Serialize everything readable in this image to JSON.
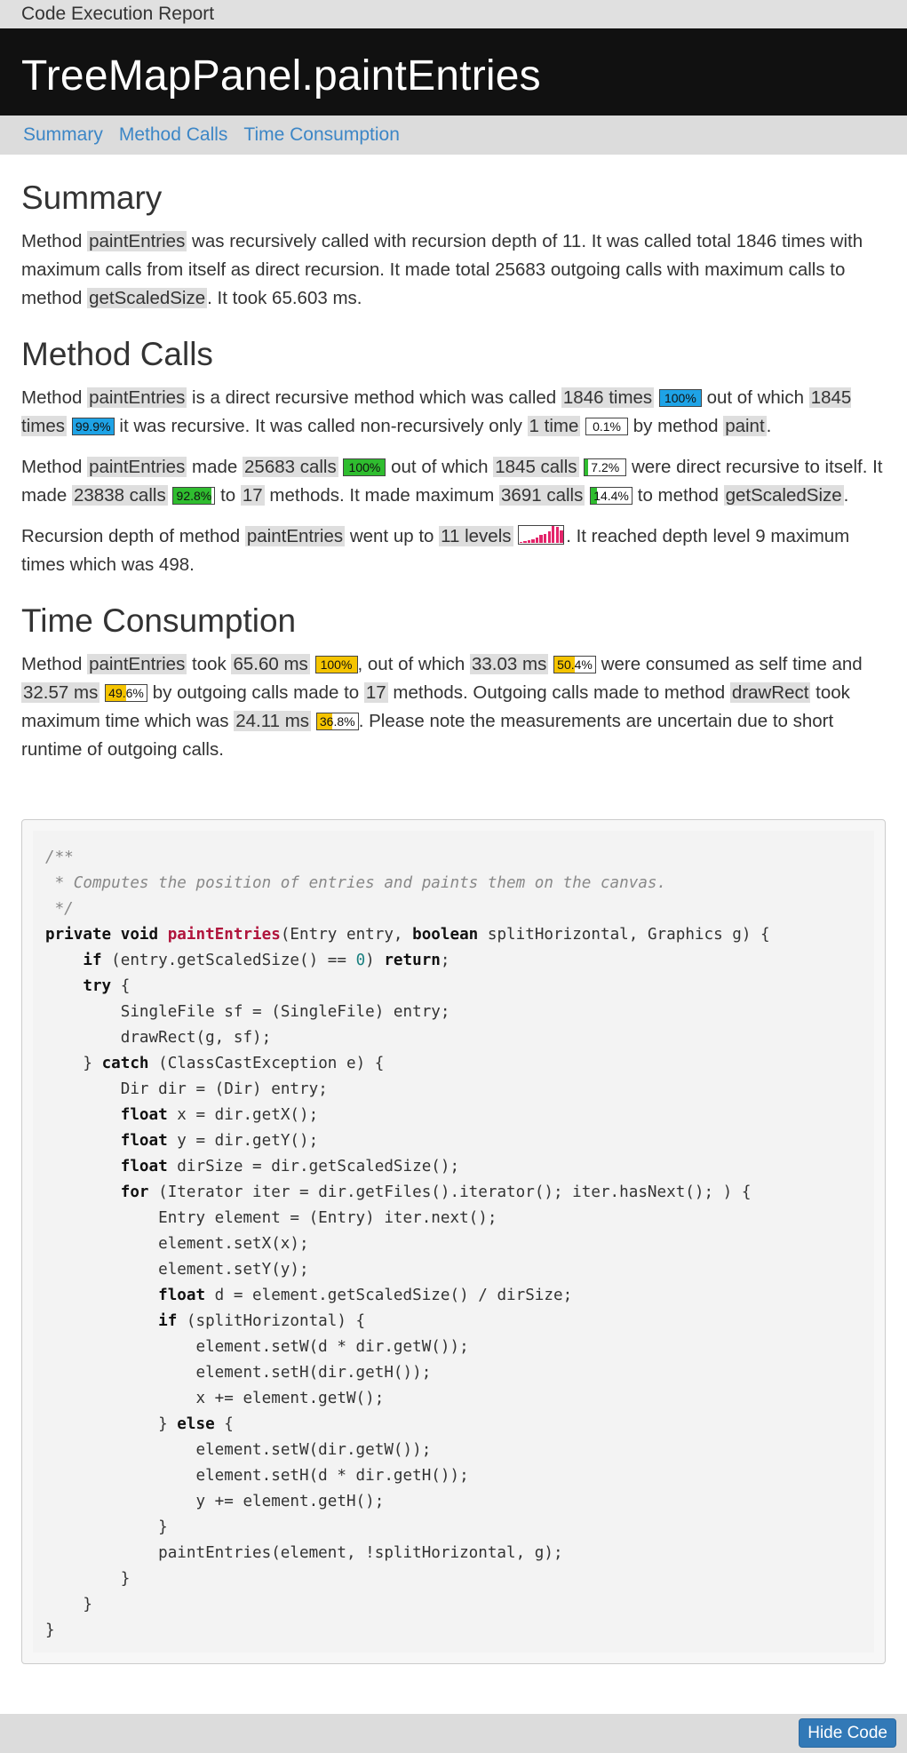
{
  "header": {
    "report_label": "Code Execution Report",
    "title": "TreeMapPanel.paintEntries"
  },
  "nav": {
    "summary": "Summary",
    "method_calls": "Method Calls",
    "time": "Time Consumption"
  },
  "colors": {
    "blue": "#1ea3e6",
    "green": "#2fbd2f",
    "yellow": "#f5c400",
    "depth_bar": "#e4246a",
    "title_bg": "#111111",
    "button": "#3279b7"
  },
  "summary": {
    "heading": "Summary",
    "t1": "Method ",
    "method": "paintEntries",
    "t2": " was recursively called with recursion depth of 11. It was called total 1846 times with maximum calls from itself as direct recursion. It made total 25683 outgoing calls with maximum calls to method ",
    "target": "getScaledSize",
    "t3": ". It took 65.603 ms."
  },
  "method_calls": {
    "heading": "Method Calls",
    "p1": {
      "a": "Method ",
      "method": "paintEntries",
      "b": " is a direct recursive method which was called ",
      "called": "1846 times",
      "called_pct": "100%",
      "c": " out of which ",
      "recursive": "1845 times",
      "recursive_pct": "99.9%",
      "d": " it was recursive. It was called non-recursively only ",
      "nonrec": "1 time",
      "nonrec_pct": "0.1%",
      "e": " by method ",
      "caller": "paint",
      "f": "."
    },
    "p2": {
      "a": "Method ",
      "method": "paintEntries",
      "b": " made ",
      "calls": "25683 calls",
      "calls_pct": "100%",
      "c": " out of which ",
      "direct": "1845 calls",
      "direct_pct": "7.2%",
      "d": " were direct recursive to itself. It made ",
      "other": "23838 calls",
      "other_pct": "92.8%",
      "e": " to ",
      "methods": "17",
      "f": " methods. It made maximum ",
      "max": "3691 calls",
      "max_pct": "14.4%",
      "g": " to method ",
      "target": "getScaledSize",
      "h": "."
    },
    "p3": {
      "a": "Recursion depth of method ",
      "method": "paintEntries",
      "b": " went up to ",
      "levels": "11 levels",
      "c": ". It reached depth level 9 maximum times which was 498."
    },
    "depth_histogram": [
      0.05,
      0.1,
      0.15,
      0.2,
      0.3,
      0.45,
      0.55,
      0.7,
      1.0,
      0.95,
      0.75
    ]
  },
  "time": {
    "heading": "Time Consumption",
    "a": "Method ",
    "method": "paintEntries",
    "b": " took ",
    "total": "65.60 ms",
    "total_pct": "100%",
    "c": ", out of which ",
    "self": "33.03 ms",
    "self_pct": "50.4%",
    "d": " were consumed as self time and ",
    "out": "32.57 ms",
    "out_pct": "49.6%",
    "e": " by outgoing calls made to ",
    "methods": "17",
    "f": " methods. Outgoing calls made to method ",
    "target": "drawRect",
    "g": " took maximum time which was ",
    "max": "24.11 ms",
    "max_pct": "36.8%",
    "h": ". Please note the measurements are uncertain due to short runtime of outgoing calls."
  },
  "code": {
    "c1": "/**",
    "c2": " * Computes the position of entries and paints them on the canvas.",
    "c3": " */",
    "private": "private",
    "void": "void",
    "fname": "paintEntries",
    "sig": "(Entry entry, ",
    "boolean": "boolean",
    "sig2": " splitHorizontal, Graphics g) {",
    "l5a": "(entry.getScaledSize() == ",
    "zero": "0",
    "l5b": ") ",
    "return": "return",
    "semi": ";",
    "l7": "SingleFile sf = (SingleFile) entry;",
    "l8": "drawRect(g, sf);",
    "catch_open": "} ",
    "catch": "catch",
    "l9": " (ClassCastException e) {",
    "l10": "Dir dir = (Dir) entry;",
    "float": "float",
    "l11": " x = dir.getX();",
    "l12": " y = dir.getY();",
    "l13": " dirSize = dir.getScaledSize();",
    "for": "for",
    "l14": " (Iterator iter = dir.getFiles().iterator(); iter.hasNext(); ) {",
    "l15": "Entry element = (Entry) iter.next();",
    "l16": "element.setX(x);",
    "l17": "element.setY(y);",
    "l18": " d = element.getScaledSize() / dirSize;",
    "if": "if",
    "l19": " (splitHorizontal) {",
    "l20": "element.setW(d * dir.getW());",
    "l21": "element.setH(dir.getH());",
    "l22": "x += element.getW();",
    "else": "else",
    "l24": "element.setW(dir.getW());",
    "l25": "element.setH(d * dir.getH());",
    "l26": "y += element.getH();",
    "l28": "paintEntries(element, !splitHorizontal, g);",
    "try": "try",
    "brace_open": " {",
    "brace_close": "}"
  },
  "footer": {
    "hide_code": "Hide Code"
  }
}
